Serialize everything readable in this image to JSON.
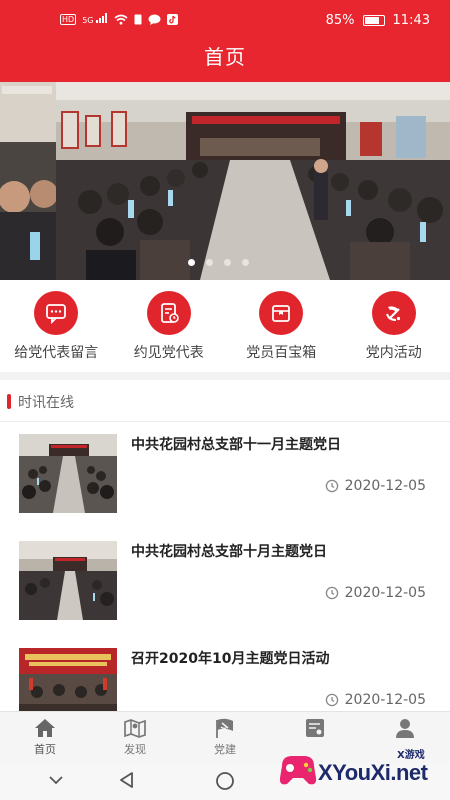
{
  "status_bar": {
    "left_icons": [
      "hd-icon",
      "5g-signal-icon",
      "wifi-icon",
      "sim-icon",
      "message-icon",
      "tiktok-icon"
    ],
    "left_text": "HD",
    "signal_text": "5G",
    "battery_percent": "85%",
    "battery_level": 0.85,
    "time": "11:43"
  },
  "header": {
    "title": "首页"
  },
  "banner": {
    "slide_count": 4,
    "active_index": 0
  },
  "quick_menu": [
    {
      "label": "给党代表留言",
      "icon": "message-icon"
    },
    {
      "label": "约见党代表",
      "icon": "appointment-icon"
    },
    {
      "label": "党员百宝箱",
      "icon": "toolbox-icon"
    },
    {
      "label": "党内活动",
      "icon": "party-emblem-icon"
    }
  ],
  "news_section": {
    "title": "时讯在线",
    "items": [
      {
        "title": "中共花园村总支部十一月主题党日",
        "date": "2020-12-05"
      },
      {
        "title": "中共花园村总支部十月主题党日",
        "date": "2020-12-05"
      },
      {
        "title": "召开2020年10月主题党日活动",
        "date": "2020-12-05"
      }
    ]
  },
  "tab_bar": [
    {
      "label": "首页",
      "icon": "home-icon",
      "active": true
    },
    {
      "label": "发现",
      "icon": "map-icon",
      "active": false
    },
    {
      "label": "党建",
      "icon": "flag-icon",
      "active": false
    },
    {
      "label": "",
      "icon": "certificate-icon",
      "active": false
    },
    {
      "label": "",
      "icon": "person-icon",
      "active": false
    }
  ],
  "watermark": {
    "text": "XYouXi.net",
    "small_text": "X游戏"
  },
  "colors": {
    "primary": "#e8262f",
    "icon_red": "#e1252c",
    "text_dark": "#222222",
    "text_gray": "#666666"
  }
}
